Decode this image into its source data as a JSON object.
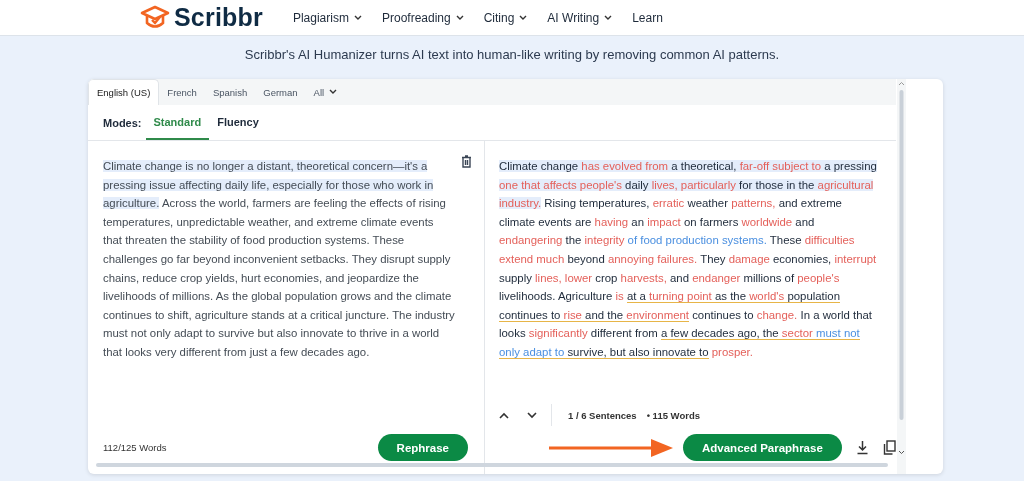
{
  "header": {
    "logo": "Scribbr",
    "nav": [
      {
        "label": "Plagiarism",
        "dropdown": true
      },
      {
        "label": "Proofreading",
        "dropdown": true
      },
      {
        "label": "Citing",
        "dropdown": true
      },
      {
        "label": "AI Writing",
        "dropdown": true
      },
      {
        "label": "Learn",
        "dropdown": false
      }
    ]
  },
  "tagline": "Scribbr's AI Humanizer turns AI text into human-like writing by removing common AI patterns.",
  "languages": [
    {
      "label": "English (US)",
      "selected": true,
      "dropdown": false
    },
    {
      "label": "French",
      "selected": false,
      "dropdown": false
    },
    {
      "label": "Spanish",
      "selected": false,
      "dropdown": false
    },
    {
      "label": "German",
      "selected": false,
      "dropdown": false
    },
    {
      "label": "All",
      "selected": false,
      "dropdown": true
    }
  ],
  "modes_label": "Modes:",
  "modes": [
    {
      "label": "Standard",
      "selected": true
    },
    {
      "label": "Fluency",
      "selected": false
    }
  ],
  "input": {
    "highlighted": "Climate change is no longer a distant, theoretical concern—it's a pressing issue affecting daily life, especially for those who work in agriculture.",
    "text": " Across the world, farmers are feeling the effects of rising temperatures, unpredictable weather, and extreme climate events that threaten the stability of food production systems. These challenges go far beyond inconvenient setbacks. They disrupt supply chains, reduce crop yields, hurt economies, and jeopardize the livelihoods of millions. As the global population grows and the climate continues to shift, agriculture stands at a critical juncture. The industry must not only adapt to survive but also innovate to thrive in a world that looks very different from just a few decades ago.",
    "word_count": "112/125 Words",
    "button": "Rephrase"
  },
  "output": {
    "segments": [
      {
        "text": "Climate change ",
        "kind": "plain",
        "highlight": true,
        "underline": false
      },
      {
        "text": "has evolved from",
        "kind": "changed",
        "highlight": true,
        "underline": false
      },
      {
        "text": " a theoretical, ",
        "kind": "plain",
        "highlight": true,
        "underline": false
      },
      {
        "text": "far-off subject to",
        "kind": "changed",
        "highlight": true,
        "underline": false
      },
      {
        "text": " a pressing ",
        "kind": "plain",
        "highlight": true,
        "underline": false
      },
      {
        "text": "one that affects people's",
        "kind": "changed",
        "highlight": true,
        "underline": false
      },
      {
        "text": " daily ",
        "kind": "plain",
        "highlight": true,
        "underline": false
      },
      {
        "text": "lives, particularly",
        "kind": "changed",
        "highlight": true,
        "underline": false
      },
      {
        "text": " for those in the ",
        "kind": "plain",
        "highlight": true,
        "underline": false
      },
      {
        "text": "agricultural industry.",
        "kind": "changed",
        "highlight": true,
        "underline": false
      },
      {
        "text": " Rising temperatures, ",
        "kind": "plain",
        "highlight": false,
        "underline": false
      },
      {
        "text": "erratic",
        "kind": "changed",
        "highlight": false,
        "underline": false
      },
      {
        "text": " weather ",
        "kind": "plain",
        "highlight": false,
        "underline": false
      },
      {
        "text": "patterns,",
        "kind": "changed",
        "highlight": false,
        "underline": false
      },
      {
        "text": " and extreme climate events are ",
        "kind": "plain",
        "highlight": false,
        "underline": false
      },
      {
        "text": "having",
        "kind": "changed",
        "highlight": false,
        "underline": false
      },
      {
        "text": " an ",
        "kind": "plain",
        "highlight": false,
        "underline": false
      },
      {
        "text": "impact",
        "kind": "changed",
        "highlight": false,
        "underline": false
      },
      {
        "text": " on farmers ",
        "kind": "plain",
        "highlight": false,
        "underline": false
      },
      {
        "text": "worldwide",
        "kind": "changed",
        "highlight": false,
        "underline": false
      },
      {
        "text": " and ",
        "kind": "plain",
        "highlight": false,
        "underline": false
      },
      {
        "text": "endangering",
        "kind": "changed",
        "highlight": false,
        "underline": false
      },
      {
        "text": " the ",
        "kind": "plain",
        "highlight": false,
        "underline": false
      },
      {
        "text": "integrity",
        "kind": "changed",
        "highlight": false,
        "underline": false
      },
      {
        "text": " of food production systems.",
        "kind": "structure",
        "highlight": false,
        "underline": false
      },
      {
        "text": " These ",
        "kind": "plain",
        "highlight": false,
        "underline": false
      },
      {
        "text": "difficulties extend much",
        "kind": "changed",
        "highlight": false,
        "underline": false
      },
      {
        "text": " beyond ",
        "kind": "plain",
        "highlight": false,
        "underline": false
      },
      {
        "text": "annoying failures.",
        "kind": "changed",
        "highlight": false,
        "underline": false
      },
      {
        "text": " They ",
        "kind": "plain",
        "highlight": false,
        "underline": false
      },
      {
        "text": "damage",
        "kind": "changed",
        "highlight": false,
        "underline": false
      },
      {
        "text": " economies, ",
        "kind": "plain",
        "highlight": false,
        "underline": false
      },
      {
        "text": "interrupt",
        "kind": "changed",
        "highlight": false,
        "underline": false
      },
      {
        "text": " supply ",
        "kind": "plain",
        "highlight": false,
        "underline": false
      },
      {
        "text": "lines, lower",
        "kind": "changed",
        "highlight": false,
        "underline": false
      },
      {
        "text": " crop ",
        "kind": "plain",
        "highlight": false,
        "underline": false
      },
      {
        "text": "harvests,",
        "kind": "changed",
        "highlight": false,
        "underline": false
      },
      {
        "text": " and ",
        "kind": "plain",
        "highlight": false,
        "underline": false
      },
      {
        "text": "endanger",
        "kind": "changed",
        "highlight": false,
        "underline": false
      },
      {
        "text": " millions of ",
        "kind": "plain",
        "highlight": false,
        "underline": false
      },
      {
        "text": "people's",
        "kind": "changed",
        "highlight": false,
        "underline": false
      },
      {
        "text": " livelihoods. Agriculture ",
        "kind": "plain",
        "highlight": false,
        "underline": false
      },
      {
        "text": "is ",
        "kind": "changed",
        "highlight": false,
        "underline": false
      },
      {
        "text": "at a ",
        "kind": "plain",
        "highlight": false,
        "underline": true
      },
      {
        "text": "turning point",
        "kind": "changed",
        "highlight": false,
        "underline": true
      },
      {
        "text": " as the ",
        "kind": "plain",
        "highlight": false,
        "underline": true
      },
      {
        "text": "world's",
        "kind": "changed",
        "highlight": false,
        "underline": true
      },
      {
        "text": " population continues to ",
        "kind": "plain",
        "highlight": false,
        "underline": true
      },
      {
        "text": "rise",
        "kind": "changed",
        "highlight": false,
        "underline": true
      },
      {
        "text": " and the ",
        "kind": "plain",
        "highlight": false,
        "underline": true
      },
      {
        "text": "environment",
        "kind": "changed",
        "highlight": false,
        "underline": true
      },
      {
        "text": " continues to ",
        "kind": "plain",
        "highlight": false,
        "underline": false
      },
      {
        "text": "change.",
        "kind": "changed",
        "highlight": false,
        "underline": false
      },
      {
        "text": " In a world that looks ",
        "kind": "plain",
        "highlight": false,
        "underline": false
      },
      {
        "text": "significantly",
        "kind": "changed",
        "highlight": false,
        "underline": false
      },
      {
        "text": " different from ",
        "kind": "plain",
        "highlight": false,
        "underline": false
      },
      {
        "text": "a few decades ago, the ",
        "kind": "plain",
        "highlight": false,
        "underline": true
      },
      {
        "text": "sector ",
        "kind": "changed",
        "highlight": false,
        "underline": true
      },
      {
        "text": "must not only adapt to",
        "kind": "structure",
        "highlight": false,
        "underline": true
      },
      {
        "text": " survive, but also innovate to",
        "kind": "plain",
        "highlight": false,
        "underline": true
      },
      {
        "text": " prosper.",
        "kind": "changed",
        "highlight": false,
        "underline": false
      }
    ],
    "sentence_counter": "1 / 6 Sentences",
    "word_count": "• 115 Words",
    "button": "Advanced Paraphrase"
  }
}
